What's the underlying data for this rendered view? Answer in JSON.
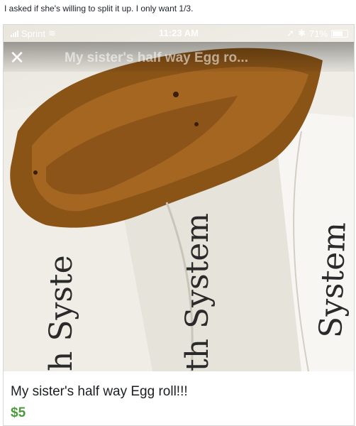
{
  "post": {
    "caption": "I asked if she's willing to split it up. I only want 1/3."
  },
  "status_bar": {
    "carrier": "Sprint",
    "time": "11:23 AM",
    "battery": "71%"
  },
  "header": {
    "close_glyph": "✕",
    "title": "My sister's half way Egg ro..."
  },
  "photo": {
    "wrapper_text": [
      "h Syste",
      "th System",
      "System"
    ],
    "food_colors": [
      "#8a5417",
      "#a96a23",
      "#6e3f10"
    ]
  },
  "listing": {
    "title": "My sister's half way Egg roll!!!",
    "price": "$5",
    "price_color": "#4a9a3c"
  }
}
